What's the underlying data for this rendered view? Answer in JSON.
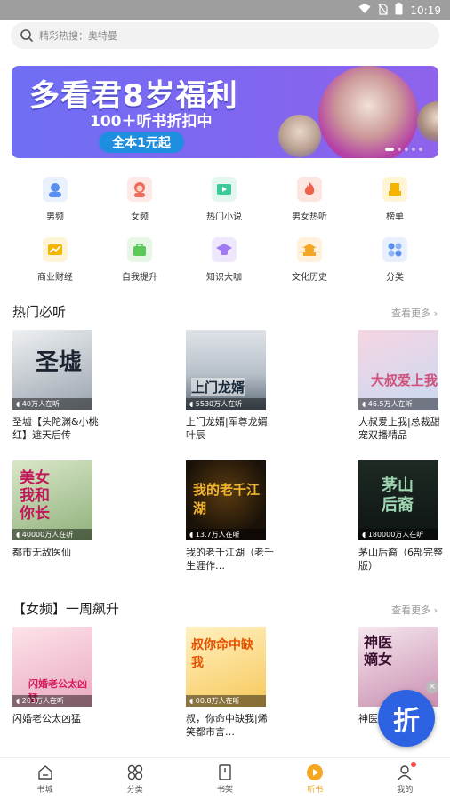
{
  "status_bar": {
    "time": "10:19",
    "icons": [
      "wifi-icon",
      "no-sim-icon",
      "battery-icon"
    ]
  },
  "search": {
    "placeholder": "精彩热搜：奥特曼"
  },
  "banner": {
    "headline": "多看君8岁福利",
    "sub": "100＋听书折扣中",
    "cta": "全本1元起",
    "slide_count": 5,
    "active_slide": 1
  },
  "categories": [
    {
      "label": "男频",
      "icon": "male-avatar-icon",
      "color": "#5a8ff0"
    },
    {
      "label": "女频",
      "icon": "female-avatar-icon",
      "color": "#f06a5a"
    },
    {
      "label": "热门小说",
      "icon": "video-play-icon",
      "color": "#3ec99a"
    },
    {
      "label": "男女热听",
      "icon": "flame-icon",
      "color": "#f0614a"
    },
    {
      "label": "榜单",
      "icon": "trophy-icon",
      "color": "#f5b400"
    },
    {
      "label": "商业财经",
      "icon": "trend-chart-icon",
      "color": "#f5b400"
    },
    {
      "label": "自我提升",
      "icon": "bag-icon",
      "color": "#5cc85a"
    },
    {
      "label": "知识大咖",
      "icon": "graduation-cap-icon",
      "color": "#a07af0"
    },
    {
      "label": "文化历史",
      "icon": "pagoda-icon",
      "color": "#f5a623"
    },
    {
      "label": "分类",
      "icon": "grid-icon",
      "color": "#5a8ff0"
    }
  ],
  "sections": [
    {
      "title": "热门必听",
      "more": "查看更多",
      "books": [
        {
          "title": "圣墟【头陀渊&小桃红】遮天后传",
          "listeners": "40万人在听",
          "cover_text": "圣墟"
        },
        {
          "title": "上门龙婿|军尊龙婿叶辰",
          "listeners": "5530万人在听",
          "cover_text": "上门龙婿"
        },
        {
          "title": "大叔爱上我|总裁甜宠双播精品",
          "listeners": "46.5万人在听",
          "cover_text": "大叔爱上我"
        },
        {
          "title": "都市无敌医仙",
          "listeners": "40000万人在听",
          "cover_text": "美女我和你长"
        },
        {
          "title": "我的老千江湖（老千生涯作…",
          "listeners": "13.7万人在听",
          "cover_text": "我的老千江湖"
        },
        {
          "title": "茅山后裔（6部完整版）",
          "listeners": "180000万人在听",
          "cover_text": "茅山后裔"
        }
      ]
    },
    {
      "title": "【女频】一周飙升",
      "more": "查看更多",
      "books": [
        {
          "title": "闪婚老公太凶猛",
          "listeners": "203万人在听",
          "cover_text": "闪婚老公太凶猛"
        },
        {
          "title": "叔，你命中缺我|烯笑都市言…",
          "listeners": "00.8万人在听",
          "cover_text": "叔你命中缺我"
        },
        {
          "title": "神医嫡女",
          "listeners": "",
          "cover_text": "神医嫡女"
        }
      ]
    }
  ],
  "fab": {
    "label": "折",
    "close": "×"
  },
  "bottom_nav": [
    {
      "label": "书城",
      "icon": "home-icon"
    },
    {
      "label": "分类",
      "icon": "grid-icon"
    },
    {
      "label": "书架",
      "icon": "bookshelf-icon"
    },
    {
      "label": "听书",
      "icon": "play-circle-icon",
      "active": true
    },
    {
      "label": "我的",
      "icon": "profile-icon",
      "badge": true
    }
  ]
}
